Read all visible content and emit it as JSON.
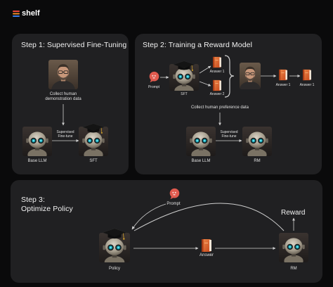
{
  "brand": {
    "name": "shelf"
  },
  "colors": {
    "background": "#0a0a0b",
    "panel": "#202022",
    "arrow": "#cfcfcf",
    "book": "#e8642a",
    "bubble": "#e05a4e",
    "logo_red": "#e8443a",
    "logo_orange": "#f28c28",
    "logo_blue": "#3a7be8"
  },
  "step1": {
    "title": "Step 1: Supervised Fine-Tuning",
    "human_label": "Collect human\ndemonstration data",
    "base_llm_label": "Base LLM",
    "sft_label": "SFT",
    "arrow_label": "Supervised\nFine-tune",
    "icons": [
      "human-photo",
      "robot-icon",
      "robot-graduate-icon"
    ]
  },
  "step2": {
    "title": "Step 2: Training a Reward Model",
    "prompt_label": "Prompt",
    "sft_label": "SFT",
    "answer1_label": "Answer 1",
    "answer2_label": "Answer 2",
    "ranked_answer1_label": "Answer 1",
    "ranked_answer1b_label": "Answer 1",
    "collect_label": "Collect human preference data",
    "base_llm_label": "Base LLM",
    "rm_label": "RM",
    "arrow_label": "Supervised\nFine-tune"
  },
  "step3": {
    "title_line1": "Step 3:",
    "title_line2": "Optimize Policy",
    "prompt_label": "Prompt",
    "policy_label": "Policy",
    "answer_label": "Answer",
    "rm_label": "RM",
    "reward_label": "Reward"
  }
}
